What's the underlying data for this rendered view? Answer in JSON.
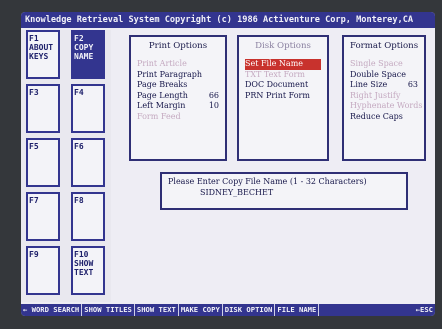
{
  "title_bar": "Knowledge Retrieval System  Copyright (c) 1986  Activenture Corp, Monterey,CA",
  "function_keys": [
    {
      "label": "F1\nABOUT\nKEYS",
      "active": false
    },
    {
      "label": "F2\nCOPY\nNAME",
      "active": true
    },
    {
      "label": "F3",
      "active": false
    },
    {
      "label": "F4",
      "active": false
    },
    {
      "label": "F5",
      "active": false
    },
    {
      "label": "F6",
      "active": false
    },
    {
      "label": "F7",
      "active": false
    },
    {
      "label": "F8",
      "active": false
    },
    {
      "label": "F9",
      "active": false
    },
    {
      "label": "F10\nSHOW\nTEXT",
      "active": false
    }
  ],
  "print_options": {
    "title": "Print Options",
    "items": [
      {
        "label": "Print Article",
        "value": "",
        "state": "disabled"
      },
      {
        "label": "Print Paragraph",
        "value": "",
        "state": "enabled"
      },
      {
        "label": "Page Breaks",
        "value": "",
        "state": "enabled"
      },
      {
        "label": "Page Length",
        "value": "66",
        "state": "enabled"
      },
      {
        "label": "Left Margin",
        "value": "10",
        "state": "enabled"
      },
      {
        "label": "Form Feed",
        "value": "",
        "state": "disabled"
      }
    ]
  },
  "disk_options": {
    "title": "Disk Options",
    "items": [
      {
        "label": "Set File Name",
        "state": "selected"
      },
      {
        "label": "TXT Text Form",
        "state": "disabled"
      },
      {
        "label": "DOC Document",
        "state": "enabled"
      },
      {
        "label": "PRN Print Form",
        "state": "enabled"
      }
    ]
  },
  "format_options": {
    "title": "Format Options",
    "items": [
      {
        "label": "Single Space",
        "value": "",
        "state": "disabled"
      },
      {
        "label": "Double Space",
        "value": "",
        "state": "enabled"
      },
      {
        "label": "Line Size",
        "value": "63",
        "state": "enabled"
      },
      {
        "label": "Right Justify",
        "value": "",
        "state": "disabled"
      },
      {
        "label": "Hyphenate Words",
        "value": "",
        "state": "disabled"
      },
      {
        "label": "Reduce Caps",
        "value": "",
        "state": "enabled"
      }
    ]
  },
  "dialog": {
    "prompt": "Please Enter Copy File Name (1 - 32 Characters)",
    "value": "SIDNEY_BECHET"
  },
  "bottom_bar": [
    "← WORD SEARCH",
    "SHOW TITLES",
    "SHOW TEXT",
    "MAKE COPY",
    "DISK OPTION",
    "FILE NAME",
    "←ESC"
  ],
  "colors": {
    "accent": "#33358f",
    "selected": "#c8322d",
    "background": "#eeedf4"
  }
}
